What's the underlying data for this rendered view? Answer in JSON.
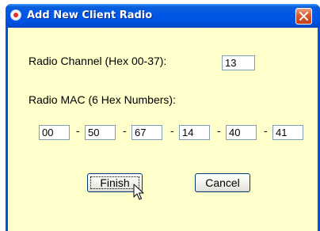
{
  "window": {
    "title": "Add New Client Radio"
  },
  "form": {
    "channel_label": "Radio Channel (Hex 00-37):",
    "channel_value": "13",
    "mac_label": "Radio MAC (6 Hex Numbers):",
    "mac_octets": [
      "00",
      "50",
      "67",
      "14",
      "40",
      "41"
    ],
    "separator": "-"
  },
  "buttons": {
    "finish_label": "Finish",
    "cancel_label": "Cancel"
  },
  "colors": {
    "client_background": "#ffffcc",
    "titlebar": "#0054e3",
    "close_button": "#d8572f"
  },
  "icons": {
    "title_icon": "radio-dot-icon",
    "close_icon": "close-x-icon",
    "cursor": "mouse-pointer-icon"
  }
}
